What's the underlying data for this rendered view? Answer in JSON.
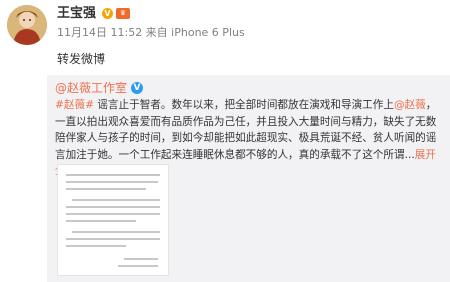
{
  "post": {
    "author": "王宝强",
    "meta": "11月14日 11:52 来自 iPhone 6 Plus",
    "repost_note": "转发微博"
  },
  "quoted": {
    "source": "@赵薇工作室",
    "segments": [
      {
        "t": "#赵薇#",
        "k": "hashtag"
      },
      {
        "t": " 谣言止于智者。数年以来，把全部时间都放在演戏和导演工作上",
        "k": "text"
      },
      {
        "t": "@赵薇",
        "k": "mention"
      },
      {
        "t": "，一直以拍出观众喜爱而有品质作品为己任，并且投入大量时间与精力，缺失了无数陪伴家人与孩子的时间，到如今却能把如此超现实、极具荒诞不经、贫人听闻的谣言加注于她。一个工作起来连睡眠休息都不够的人，真的承载不了这个所谓",
        "k": "text"
      },
      {
        "t": "...",
        "k": "text"
      },
      {
        "t": "展开全文",
        "k": "expand"
      },
      {
        "t": "∨",
        "k": "expand"
      }
    ]
  },
  "icons": {
    "avatar": "avatar-image",
    "verified": "verified-v-icon",
    "badges": [
      "gold-v-badge",
      "vip-badge"
    ]
  },
  "colors": {
    "link_orange": "#eb7350",
    "quote_bg": "#f2f2f5",
    "meta_gray": "#808080"
  }
}
